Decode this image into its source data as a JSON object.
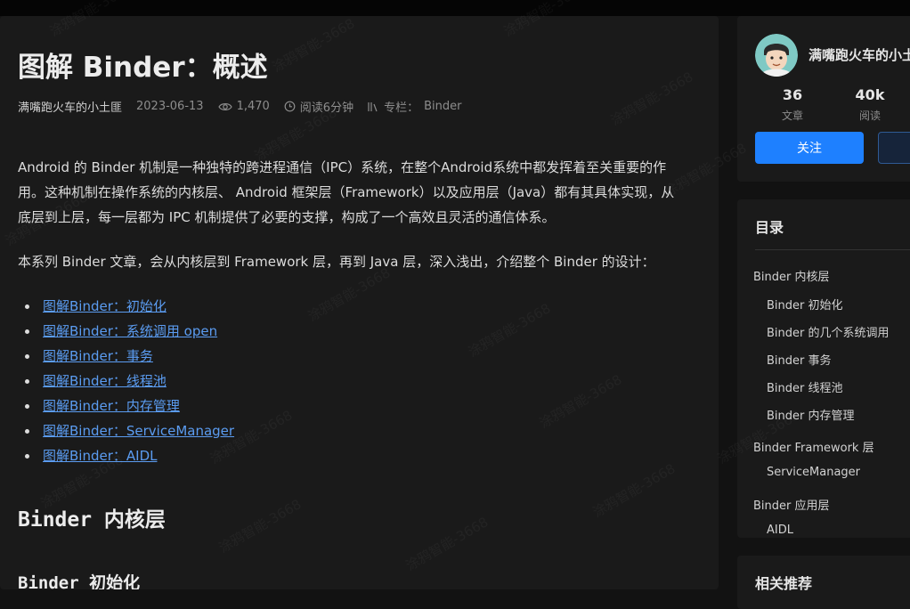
{
  "article": {
    "title": "图解 Binder：概述",
    "author": "满嘴跑火车的小土匪",
    "date": "2023-06-13",
    "views": "1,470",
    "read_time": "阅读6分钟",
    "column_label": "专栏：",
    "column_name": "Binder",
    "paragraph1": "Android 的 Binder 机制是一种独特的跨进程通信（IPC）系统，在整个Android系统中都发挥着至关重要的作用。这种机制在操作系统的内核层、 Android 框架层（Framework）以及应用层（Java）都有其具体实现，从底层到上层，每一层都为 IPC 机制提供了必要的支撑，构成了一个高效且灵活的通信体系。",
    "paragraph2": "本系列 Binder 文章，会从内核层到 Framework 层，再到 Java 层，深入浅出，介绍整个 Binder 的设计：",
    "links": [
      "图解Binder：初始化",
      "图解Binder：系统调用 open",
      "图解Binder：事务",
      "图解Binder：线程池",
      "图解Binder：内存管理",
      "图解Binder：ServiceManager",
      "图解Binder：AIDL"
    ],
    "heading_kernel": "Binder 内核层",
    "heading_init": "Binder 初始化"
  },
  "author_card": {
    "name": "满嘴跑火车的小土",
    "articles_count": "36",
    "articles_label": "文章",
    "reads_count": "40k",
    "reads_label": "阅读",
    "follow_label": "关注"
  },
  "toc": {
    "title": "目录",
    "items": [
      "Binder 内核层",
      "Binder 初始化",
      "Binder 的几个系统调用",
      "Binder 事务",
      "Binder 线程池",
      "Binder 内存管理",
      "Binder Framework 层",
      "ServiceManager",
      "Binder 应用层",
      "AIDL"
    ]
  },
  "recommend": {
    "title": "相关推荐"
  },
  "watermark": "涂鸦智能-3668",
  "colors": {
    "accent": "#1e80ff",
    "link": "#5b9cf1",
    "background": "#121212",
    "card": "#1a1a1a"
  }
}
